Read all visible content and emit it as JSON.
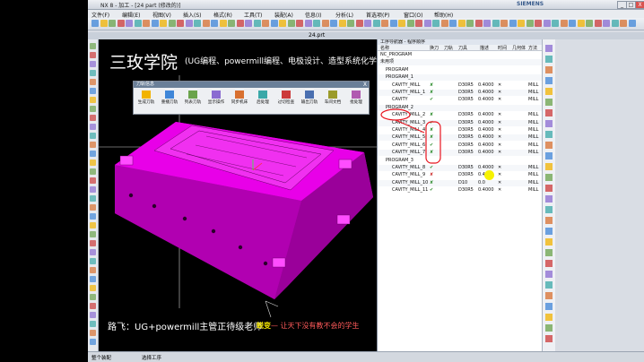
{
  "window": {
    "title": "NX 8 - 加工 - [24 part (修改的)]",
    "brand": "SIEMENS",
    "buttons": {
      "minimize": "_",
      "maximize": "□",
      "close": "X"
    }
  },
  "menu": [
    "文件(F)",
    "编辑(E)",
    "视图(V)",
    "插入(S)",
    "格式(R)",
    "工具(T)",
    "装配(A)",
    "信息(I)",
    "分析(L)",
    "首选项(P)",
    "窗口(O)",
    "帮助(H)"
  ],
  "doc_tab": "24.prt",
  "overlay": {
    "title": "三玫学院",
    "subtitle": "(UG编程、powermill编程、电极设计、造型系统化学习)",
    "caption_left": "路飞：UG+powermill主管正待级老师",
    "caption_right_a": "蜕变",
    "caption_right_b": "— 让天下没有教不会的学生"
  },
  "dialog": {
    "title": "刀轨信息",
    "close": "X",
    "buttons": [
      "生成刀轨",
      "重播刀轨",
      "列表刀轨",
      "显示操作",
      "同步机床",
      "后处理",
      "过切检查",
      "输出刀轨",
      "车间文档",
      "批处理"
    ]
  },
  "navigator": {
    "header": "工序导航器 - 程序顺序",
    "columns": [
      "名称",
      "换刀",
      "刀轨",
      "刀具",
      "描述",
      "时间",
      "几何体",
      "方法"
    ],
    "rows": [
      {
        "name": "NC_PROGRAM",
        "tool": "",
        "time": "",
        "method": ""
      },
      {
        "name": "未用项",
        "tool": "",
        "time": "",
        "method": ""
      },
      {
        "name": "PROGRAM",
        "tool": "",
        "time": "",
        "method": ""
      },
      {
        "name": "PROGRAM_1",
        "tool": "",
        "time": "",
        "method": ""
      },
      {
        "name": "CAVITY_MILL",
        "tool": "D30R5",
        "time": "0.4000",
        "method": "MILL"
      },
      {
        "name": "CAVITY_MILL_1",
        "tool": "D30R5",
        "time": "0.4000",
        "method": "MILL"
      },
      {
        "name": "CAVITY",
        "tool": "D30R5",
        "time": "0.4000",
        "method": "MILL"
      },
      {
        "name": "PROGRAM_2",
        "tool": "",
        "time": "",
        "method": ""
      },
      {
        "name": "CAVITY_MILL_2",
        "tool": "D30R5",
        "time": "0.4000",
        "method": "MILL"
      },
      {
        "name": "CAVITY_MILL_3",
        "tool": "D30R5",
        "time": "0.4000",
        "method": "MILL"
      },
      {
        "name": "CAVITY_MILL_4",
        "tool": "D30R5",
        "time": "0.4000",
        "method": "MILL"
      },
      {
        "name": "CAVITY_MILL_5",
        "tool": "D30R5",
        "time": "0.4000",
        "method": "MILL"
      },
      {
        "name": "CAVITY_MILL_6",
        "tool": "D30R5",
        "time": "0.4000",
        "method": "MILL"
      },
      {
        "name": "CAVITY_MILL_7",
        "tool": "D30R5",
        "time": "0.4000",
        "method": "MILL"
      },
      {
        "name": "PROGRAM_3",
        "tool": "",
        "time": "",
        "method": ""
      },
      {
        "name": "CAVITY_MILL_8",
        "tool": "D30R5",
        "time": "0.4000",
        "method": "MILL"
      },
      {
        "name": "CAVITY_MILL_9",
        "tool": "D30R5",
        "time": "0.4000",
        "method": "MILL"
      },
      {
        "name": "CAVITY_MILL_10",
        "tool": "D10",
        "time": "0.0",
        "method": "MILL"
      },
      {
        "name": "CAVITY_MILL_11",
        "tool": "D30R5",
        "time": "0.4000",
        "method": "MILL"
      }
    ]
  },
  "statusbar": {
    "left": "整个装配",
    "mid": "选择工序"
  },
  "colors": {
    "part": "#e800e8",
    "annotation": "#e8141e",
    "viewport_bg": "#000000",
    "cursor": "#f6f200"
  }
}
